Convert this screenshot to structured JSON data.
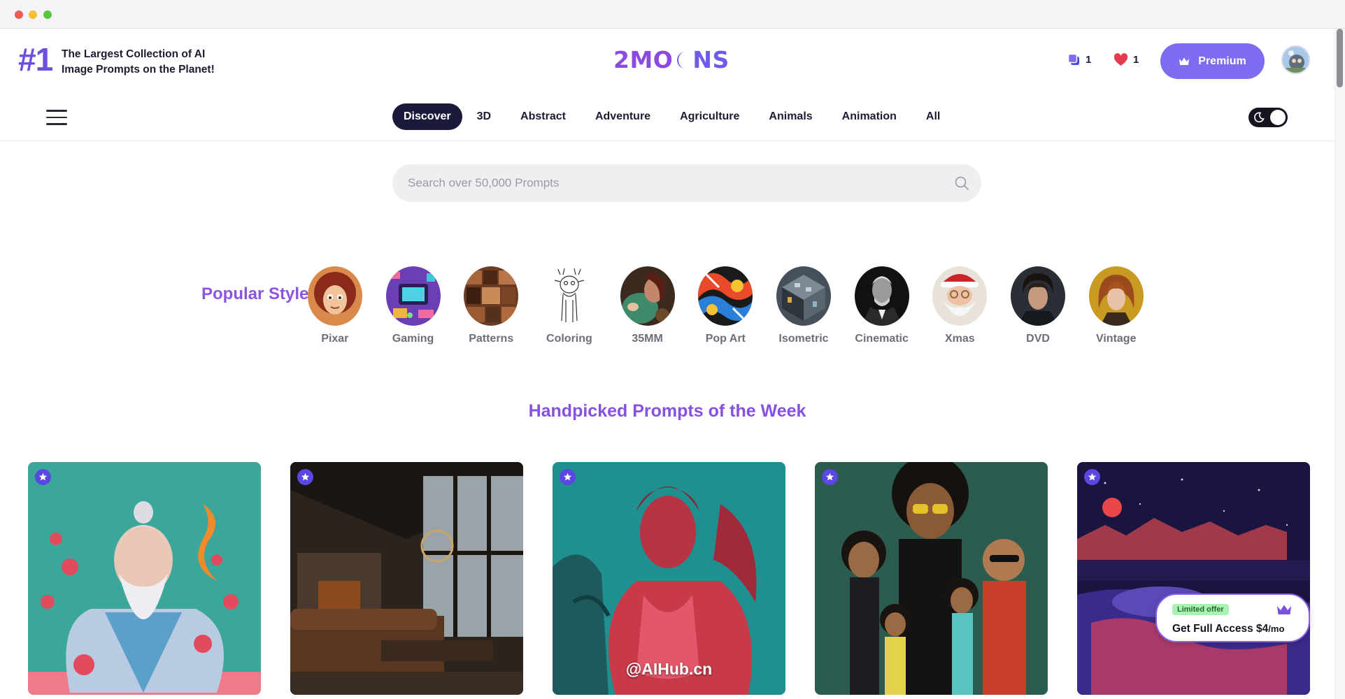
{
  "header": {
    "rank": "#1",
    "tagline": "The Largest Collection of AI Image Prompts on the Planet!",
    "logo_left": "2MO",
    "logo_right": "NS",
    "copy_count": "1",
    "favorites_count": "1",
    "premium_label": "Premium"
  },
  "nav": {
    "items": [
      "Discover",
      "3D",
      "Abstract",
      "Adventure",
      "Agriculture",
      "Animals",
      "Animation",
      "All"
    ]
  },
  "search": {
    "placeholder": "Search over 50,000 Prompts"
  },
  "popular_styles": {
    "title": "Popular Styles",
    "items": [
      "Pixar",
      "Gaming",
      "Patterns",
      "Coloring",
      "35MM",
      "Pop Art",
      "Isometric",
      "Cinematic",
      "Xmas",
      "DVD",
      "Vintage"
    ]
  },
  "handpicked": {
    "title": "Handpicked Prompts of the Week",
    "watermark": "@AIHub.cn"
  },
  "offer": {
    "badge": "Limited offer",
    "cta_main": "Get Full Access $4",
    "cta_suffix": "/mo"
  },
  "colors": {
    "accent": "#7c6cf0",
    "logo_purple": "#8c4be0",
    "nav_active": "#1c1a3a",
    "section_title": "#8650e0"
  },
  "icons": [
    "copy-icon",
    "heart-icon",
    "crown-icon",
    "menu-icon",
    "moon-icon",
    "search-icon",
    "star-icon"
  ]
}
